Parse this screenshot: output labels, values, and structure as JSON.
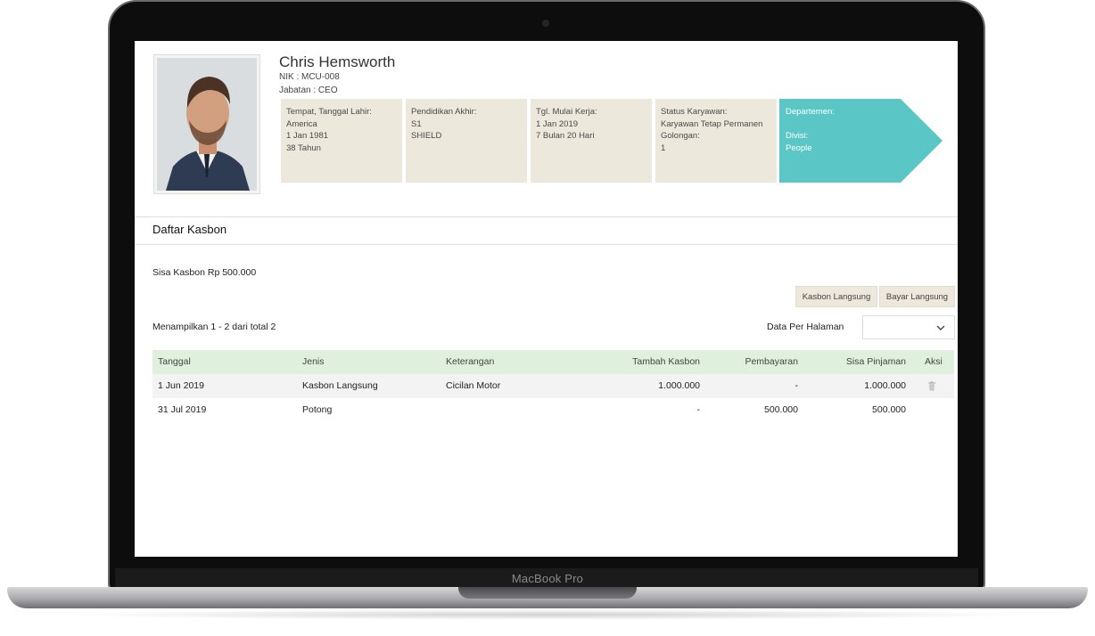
{
  "device": {
    "brand_label": "MacBook Pro"
  },
  "employee": {
    "name": "Chris Hemsworth",
    "nik": "NIK : MCU-008",
    "jabatan": "Jabatan : CEO",
    "info_boxes": [
      {
        "label": "Tempat, Tanggal Lahir:",
        "lines": [
          "America",
          "1 Jan 1981",
          "38 Tahun"
        ]
      },
      {
        "label": "Pendidikan Akhir:",
        "lines": [
          "S1",
          "SHIELD"
        ]
      },
      {
        "label": "Tgl. Mulai Kerja:",
        "lines": [
          "1 Jan 2019",
          "7 Bulan 20 Hari"
        ]
      },
      {
        "label": "Status Karyawan:",
        "lines": [
          "Karyawan Tetap Permanen",
          "Golongan:",
          "1"
        ]
      }
    ],
    "department": {
      "label": "Departemen:",
      "divisi_label": "Divisi:",
      "divisi_value": "People",
      "color": "#5bc6c6"
    }
  },
  "kasbon": {
    "title": "Daftar Kasbon",
    "sisa": "Sisa Kasbon Rp 500.000",
    "buttons": {
      "kasbon_langsung": "Kasbon Langsung",
      "bayar_langsung": "Bayar Langsung"
    },
    "showing": "Menampilkan 1 - 2 dari total 2",
    "per_page_label": "Data Per Halaman",
    "per_page_value": "",
    "table": {
      "headers": [
        "Tanggal",
        "Jenis",
        "Keterangan",
        "Tambah Kasbon",
        "Pembayaran",
        "Sisa Pinjaman",
        "Aksi"
      ],
      "rows": [
        {
          "tanggal": "1 Jun 2019",
          "jenis": "Kasbon Langsung",
          "keterangan": "Cicilan Motor",
          "tambah": "1.000.000",
          "pembayaran": "-",
          "sisa": "1.000.000",
          "aksi_icon": "trash-icon"
        },
        {
          "tanggal": "31 Jul 2019",
          "jenis": "Potong",
          "keterangan": "",
          "tambah": "-",
          "pembayaran": "500.000",
          "sisa": "500.000"
        }
      ]
    }
  },
  "colors": {
    "info_box_bg": "#ede8dc",
    "table_header_bg": "#dff0dc",
    "accent_teal": "#5bc6c6"
  }
}
